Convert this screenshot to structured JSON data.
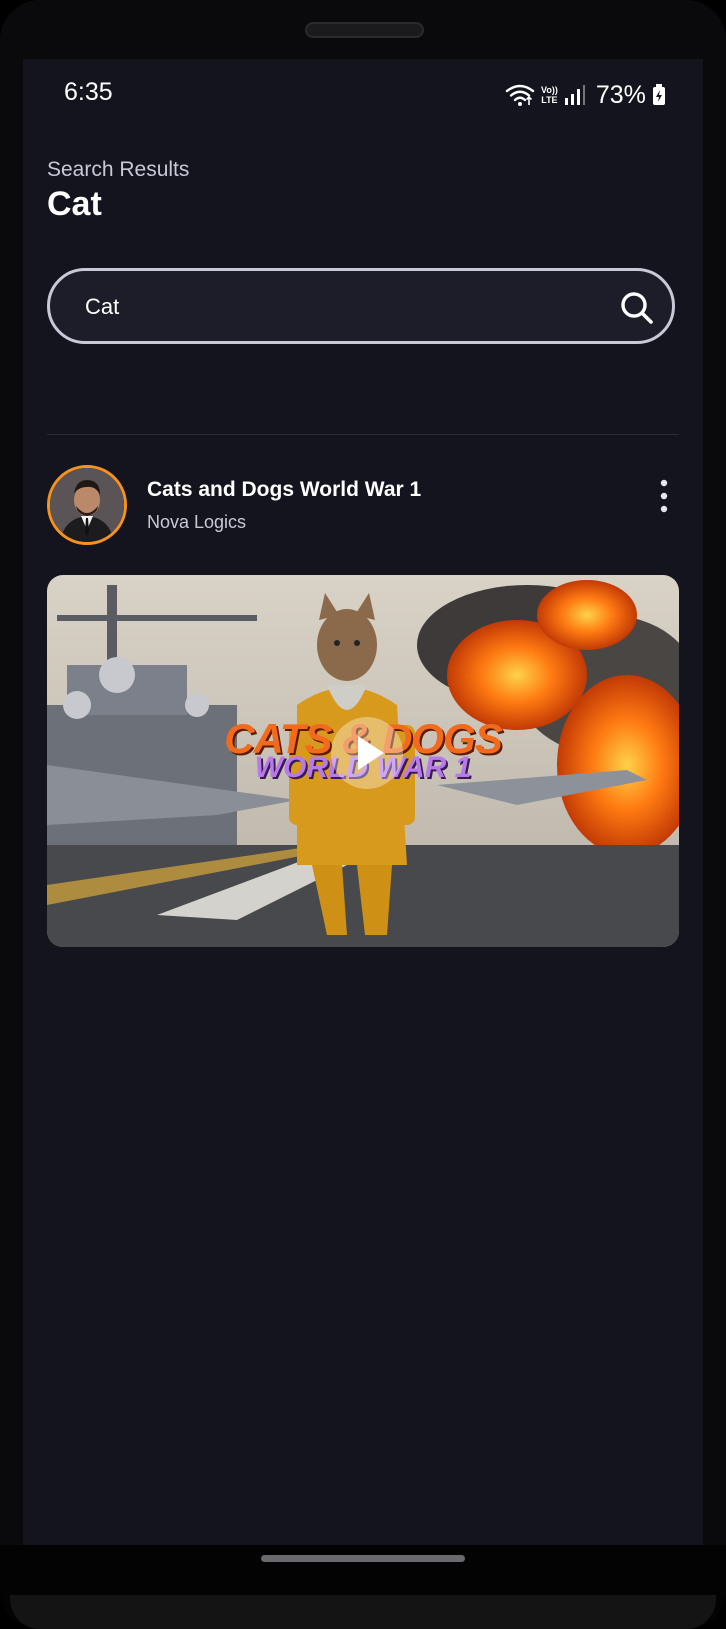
{
  "status_bar": {
    "time": "6:35",
    "battery": "73%",
    "network_top": "Vo))",
    "network_bottom": "LTE"
  },
  "header": {
    "subtitle": "Search Results",
    "title": "Cat"
  },
  "search": {
    "value": "Cat",
    "placeholder": ""
  },
  "results": [
    {
      "title": "Cats and Dogs World War 1",
      "channel": "Nova Logics",
      "thumbnail_text_line1": "CATS & DOGS",
      "thumbnail_text_line2": "WORLD WAR 1"
    }
  ],
  "colors": {
    "background": "#14141f",
    "avatar_ring": "#f7921e",
    "search_border": "#c8c8d6"
  },
  "icons": [
    "wifi-icon",
    "signal-icon",
    "battery-icon",
    "search-icon",
    "more-vertical-icon",
    "play-icon"
  ]
}
